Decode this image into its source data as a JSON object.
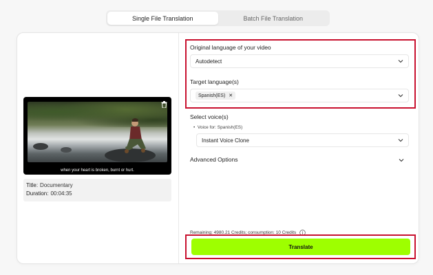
{
  "tabs": {
    "single": "Single File Translation",
    "batch": "Batch File Translation"
  },
  "video": {
    "subtitle": "when your heart is broken, burnt or hurt."
  },
  "info": {
    "title_key": "Title:",
    "title_val": "Documentary",
    "duration_key": "Duration:",
    "duration_val": "00:04:35"
  },
  "form": {
    "orig_label": "Original language of your video",
    "orig_value": "Autodetect",
    "target_label": "Target language(s)",
    "target_chip": "Spanish(ES)",
    "voice_label": "Select voice(s)",
    "voice_for": "Voice for: Spanish(ES)",
    "voice_value": "Instant Voice Clone",
    "advanced": "Advanced Options"
  },
  "credits": "Remaining: 4980.21 Credits; consumption: 10 Credits",
  "translate_label": "Translate",
  "colors": {
    "accent": "#9eff00",
    "highlight_border": "#c8102e"
  },
  "icons": [
    "trash-icon",
    "chevron-down-icon",
    "close-icon",
    "info-icon",
    "bullet-icon"
  ]
}
